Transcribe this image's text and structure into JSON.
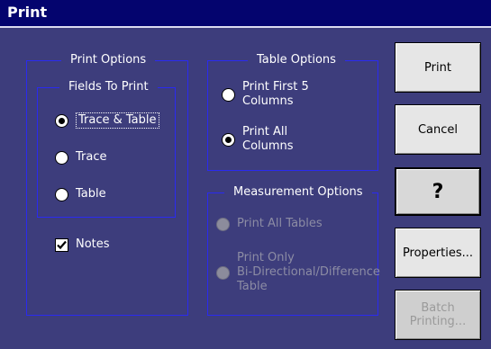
{
  "window": {
    "title": "Print"
  },
  "print_options": {
    "legend": "Print Options",
    "fields": {
      "legend": "Fields To Print",
      "options": [
        {
          "label": "Trace & Table",
          "selected": true
        },
        {
          "label": "Trace",
          "selected": false
        },
        {
          "label": "Table",
          "selected": false
        }
      ]
    },
    "notes": {
      "label": "Notes",
      "checked": true
    }
  },
  "table_options": {
    "legend": "Table Options",
    "first5_line1": "Print First 5",
    "first5_line2": "Columns",
    "all_line1": "Print All",
    "all_line2": "Columns",
    "selected": "all"
  },
  "measurement_options": {
    "legend": "Measurement Options",
    "all_tables": "Print All Tables",
    "only_line1": "Print Only",
    "only_line2": "Bi-Directional/Difference",
    "only_line3": "Table",
    "enabled": false
  },
  "buttons": {
    "print": "Print",
    "cancel": "Cancel",
    "help": "?",
    "properties": "Properties...",
    "batch_line1": "Batch",
    "batch_line2": "Printing..."
  },
  "colors": {
    "background": "#3d3d7c",
    "titlebar": "#04046e",
    "group_border": "#2a2af0"
  }
}
